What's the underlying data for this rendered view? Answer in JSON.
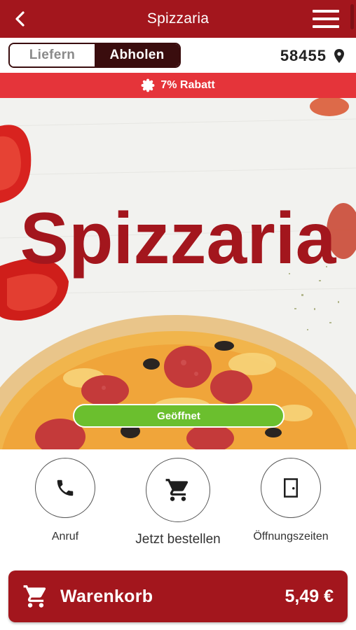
{
  "appbar": {
    "title": "Spizzaria",
    "back_icon": "back-chevron-icon",
    "menu_icon": "hamburger-menu-icon"
  },
  "mode": {
    "options": [
      {
        "label": "Liefern",
        "selected": false
      },
      {
        "label": "Abholen",
        "selected": true
      }
    ]
  },
  "location": {
    "postal_code": "58455",
    "icon": "map-pin-icon"
  },
  "discount": {
    "text": "7% Rabatt",
    "icon": "badge-icon"
  },
  "hero": {
    "logo_text": "Spizzaria",
    "status": "Geöffnet"
  },
  "actions": [
    {
      "label": "Anruf",
      "icon": "phone-icon"
    },
    {
      "label": "Jetzt bestellen",
      "icon": "cart-icon"
    },
    {
      "label": "Öffnungszeiten",
      "icon": "door-icon"
    }
  ],
  "cart": {
    "label": "Warenkorb",
    "total": "5,49 €",
    "icon": "cart-icon"
  },
  "colors": {
    "brand": "#a3161d",
    "discount": "#e5343a",
    "segment_dark": "#3a0d0e",
    "status_green": "#6bbf2e"
  }
}
